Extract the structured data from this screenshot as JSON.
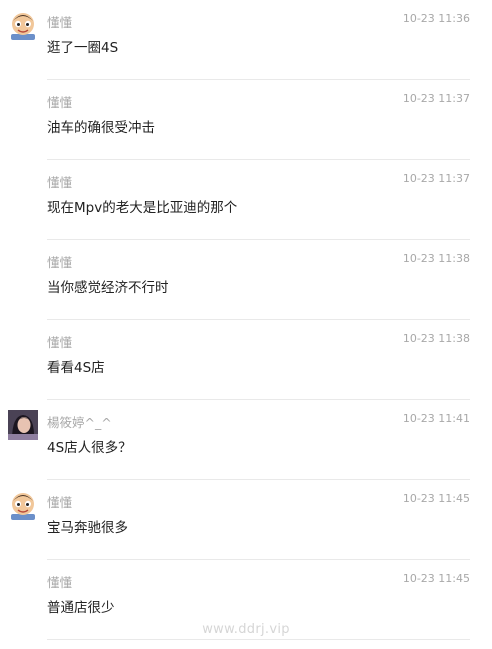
{
  "messages": [
    {
      "user": "懂懂",
      "time": "10-23 11:36",
      "text": "逛了一圈4S",
      "avatar": "cartoon-avatar"
    },
    {
      "user": "懂懂",
      "time": "10-23 11:37",
      "text": "油车的确很受冲击",
      "avatar": ""
    },
    {
      "user": "懂懂",
      "time": "10-23 11:37",
      "text": "现在Mpv的老大是比亚迪的那个",
      "avatar": ""
    },
    {
      "user": "懂懂",
      "time": "10-23 11:38",
      "text": "当你感觉经济不行时",
      "avatar": ""
    },
    {
      "user": "懂懂",
      "time": "10-23 11:38",
      "text": "看看4S店",
      "avatar": ""
    },
    {
      "user": "楊筱婷^_^",
      "time": "10-23 11:41",
      "text": "4S店人很多？",
      "avatar": "photo-avatar"
    },
    {
      "user": "懂懂",
      "time": "10-23 11:45",
      "text": "宝马奔驰很多",
      "avatar": "cartoon-avatar"
    },
    {
      "user": "懂懂",
      "time": "10-23 11:45",
      "text": "普通店很少",
      "avatar": ""
    }
  ],
  "watermark": "www.ddrj.vip"
}
